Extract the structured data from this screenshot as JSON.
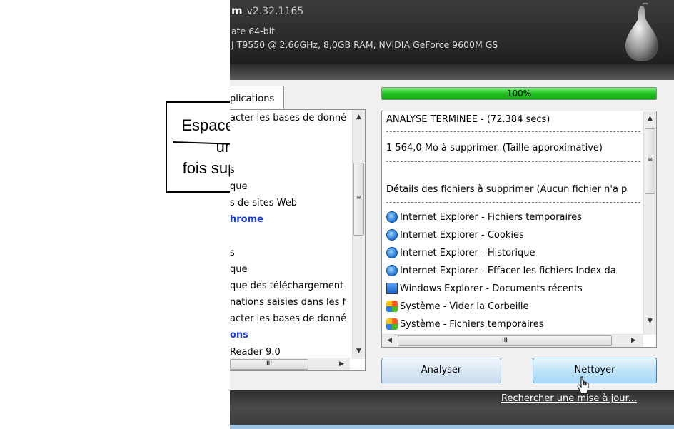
{
  "callout": {
    "line1": "Espace libéré",
    "line2": "une",
    "line3": "fois supprimé"
  },
  "app": {
    "name_fragment": "m",
    "version": "v2.32.1165",
    "os_info": "ate 64-bit",
    "hardware_info": "J T9550 @ 2.66GHz, 8,0GB RAM, NVIDIA GeForce 9600M GS"
  },
  "left_panel": {
    "tab_label": "plications",
    "items": [
      {
        "label": "acter les bases de donné",
        "bold": false
      },
      {
        "label": "",
        "bold": false
      },
      {
        "label": "s",
        "bold": false
      },
      {
        "label": "que",
        "bold": false
      },
      {
        "label": "s de sites Web",
        "bold": false
      },
      {
        "label": "hrome",
        "bold": true
      },
      {
        "label": "",
        "bold": false
      },
      {
        "label": "s",
        "bold": false
      },
      {
        "label": "que",
        "bold": false
      },
      {
        "label": "que des téléchargement",
        "bold": false
      },
      {
        "label": "nations saisies dans les f",
        "bold": false
      },
      {
        "label": "acter les bases de donné",
        "bold": false
      },
      {
        "label": "ons",
        "bold": true
      },
      {
        "label": "Reader 9.0",
        "bold": false
      }
    ]
  },
  "progress": {
    "label": "100%",
    "value": 1.0,
    "color": "#21c021"
  },
  "results": {
    "status": "ANALYSE TERMINEE - (72.384 secs)",
    "size_line": "1 564,0 Mo à supprimer. (Taille approximative)",
    "details_header": "Détails des fichiers à supprimer (Aucun fichier n'a p",
    "items": [
      {
        "icon": "internet-explorer-icon",
        "label": "Internet Explorer - Fichiers temporaires"
      },
      {
        "icon": "internet-explorer-icon",
        "label": "Internet Explorer - Cookies"
      },
      {
        "icon": "internet-explorer-icon",
        "label": "Internet Explorer - Historique"
      },
      {
        "icon": "internet-explorer-icon",
        "label": "Internet Explorer - Effacer les fichiers Index.da"
      },
      {
        "icon": "windows-explorer-icon",
        "label": "Windows Explorer - Documents récents"
      },
      {
        "icon": "windows-system-icon",
        "label": "Système - Vider la Corbeille"
      },
      {
        "icon": "windows-system-icon",
        "label": "Système - Fichiers temporaires"
      }
    ]
  },
  "buttons": {
    "analyze": "Analyser",
    "clean": "Nettoyer"
  },
  "footer": {
    "update_link": "Rechercher une mise à jour..."
  },
  "scroll_glyphs": {
    "up": "▲",
    "down": "▼",
    "left": "◀",
    "right": "▶",
    "grip_v": "≡",
    "grip_h": "III"
  }
}
